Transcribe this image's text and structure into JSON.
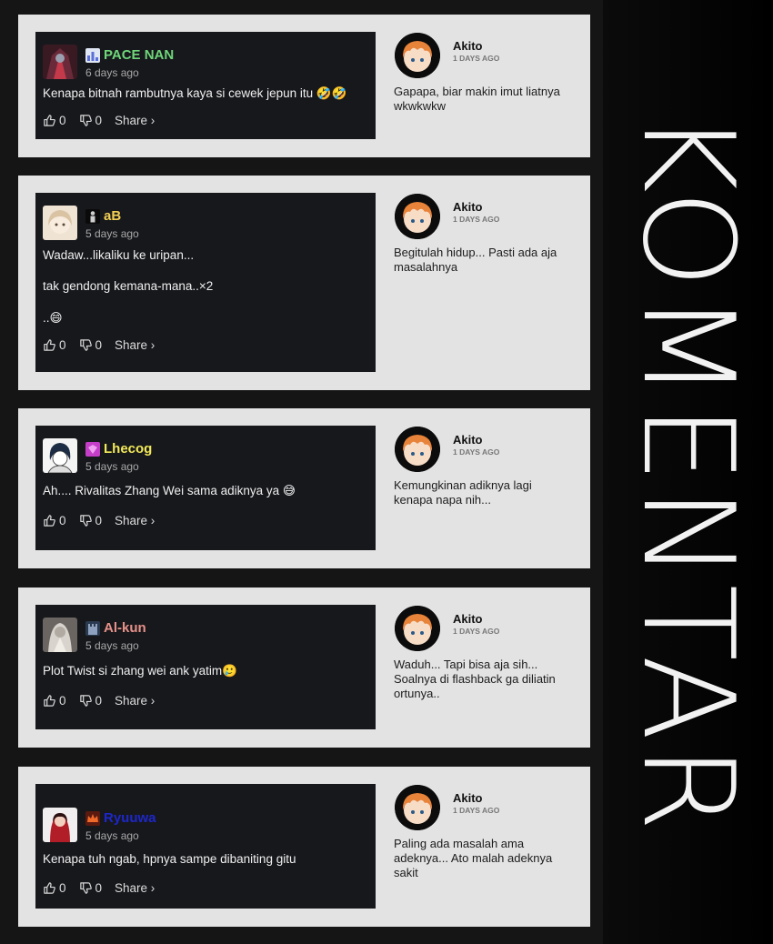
{
  "title": "KOMENTAR",
  "panels": [
    {
      "comment": {
        "username": "PACE NAN",
        "username_color": "#6fd67a",
        "badge_icon": "chart-badge-icon",
        "date": "6 days ago",
        "lines": [
          "Kenapa bitnah rambutnya kaya si cewek jepun itu 🤣🤣"
        ],
        "likes": "0",
        "dislikes": "0",
        "share_label": "Share ›"
      },
      "reply": {
        "name": "Akito",
        "date": "1 DAYS AGO",
        "text": "Gapapa, biar makin imut liatnya wkwkwkw"
      }
    },
    {
      "comment": {
        "username": "aB",
        "username_color": "#f2cf54",
        "badge_icon": "figure-badge-icon",
        "date": "5 days ago",
        "lines": [
          "Wadaw...likaliku ke uripan...",
          "tak gendong kemana-mana..×2",
          "..😄"
        ],
        "likes": "0",
        "dislikes": "0",
        "share_label": "Share ›"
      },
      "reply": {
        "name": "Akito",
        "date": "1 DAYS AGO",
        "text": "Begitulah hidup... Pasti ada aja masalahnya"
      }
    },
    {
      "comment": {
        "username": "Lhecog",
        "username_color": "#f2e95a",
        "badge_icon": "gem-badge-icon",
        "date": "5 days ago",
        "lines": [
          "Ah.... Rivalitas Zhang Wei sama adiknya ya 😅"
        ],
        "likes": "0",
        "dislikes": "0",
        "share_label": "Share ›"
      },
      "reply": {
        "name": "Akito",
        "date": "1 DAYS AGO",
        "text": "Kemungkinan adiknya lagi kenapa napa nih..."
      }
    },
    {
      "comment": {
        "username": "Al-kun",
        "username_color": "#e7928a",
        "badge_icon": "castle-badge-icon",
        "date": "5 days ago",
        "lines": [
          "Plot Twist si zhang wei ank yatim🥲"
        ],
        "likes": "0",
        "dislikes": "0",
        "share_label": "Share ›"
      },
      "reply": {
        "name": "Akito",
        "date": "1 DAYS AGO",
        "text": "Waduh... Tapi bisa aja sih... Soalnya di flashback ga diliatin ortunya.."
      }
    },
    {
      "comment": {
        "username": "Ryuuwa",
        "username_color": "#1d27c9",
        "badge_icon": "crown-badge-icon",
        "date": "5 days ago",
        "lines": [
          "Kenapa tuh ngab, hpnya sampe dibaniting gitu"
        ],
        "likes": "0",
        "dislikes": "0",
        "share_label": "Share ›"
      },
      "reply": {
        "name": "Akito",
        "date": "1 DAYS AGO",
        "text": "Paling ada masalah ama adeknya... Ato malah adeknya sakit"
      }
    }
  ]
}
